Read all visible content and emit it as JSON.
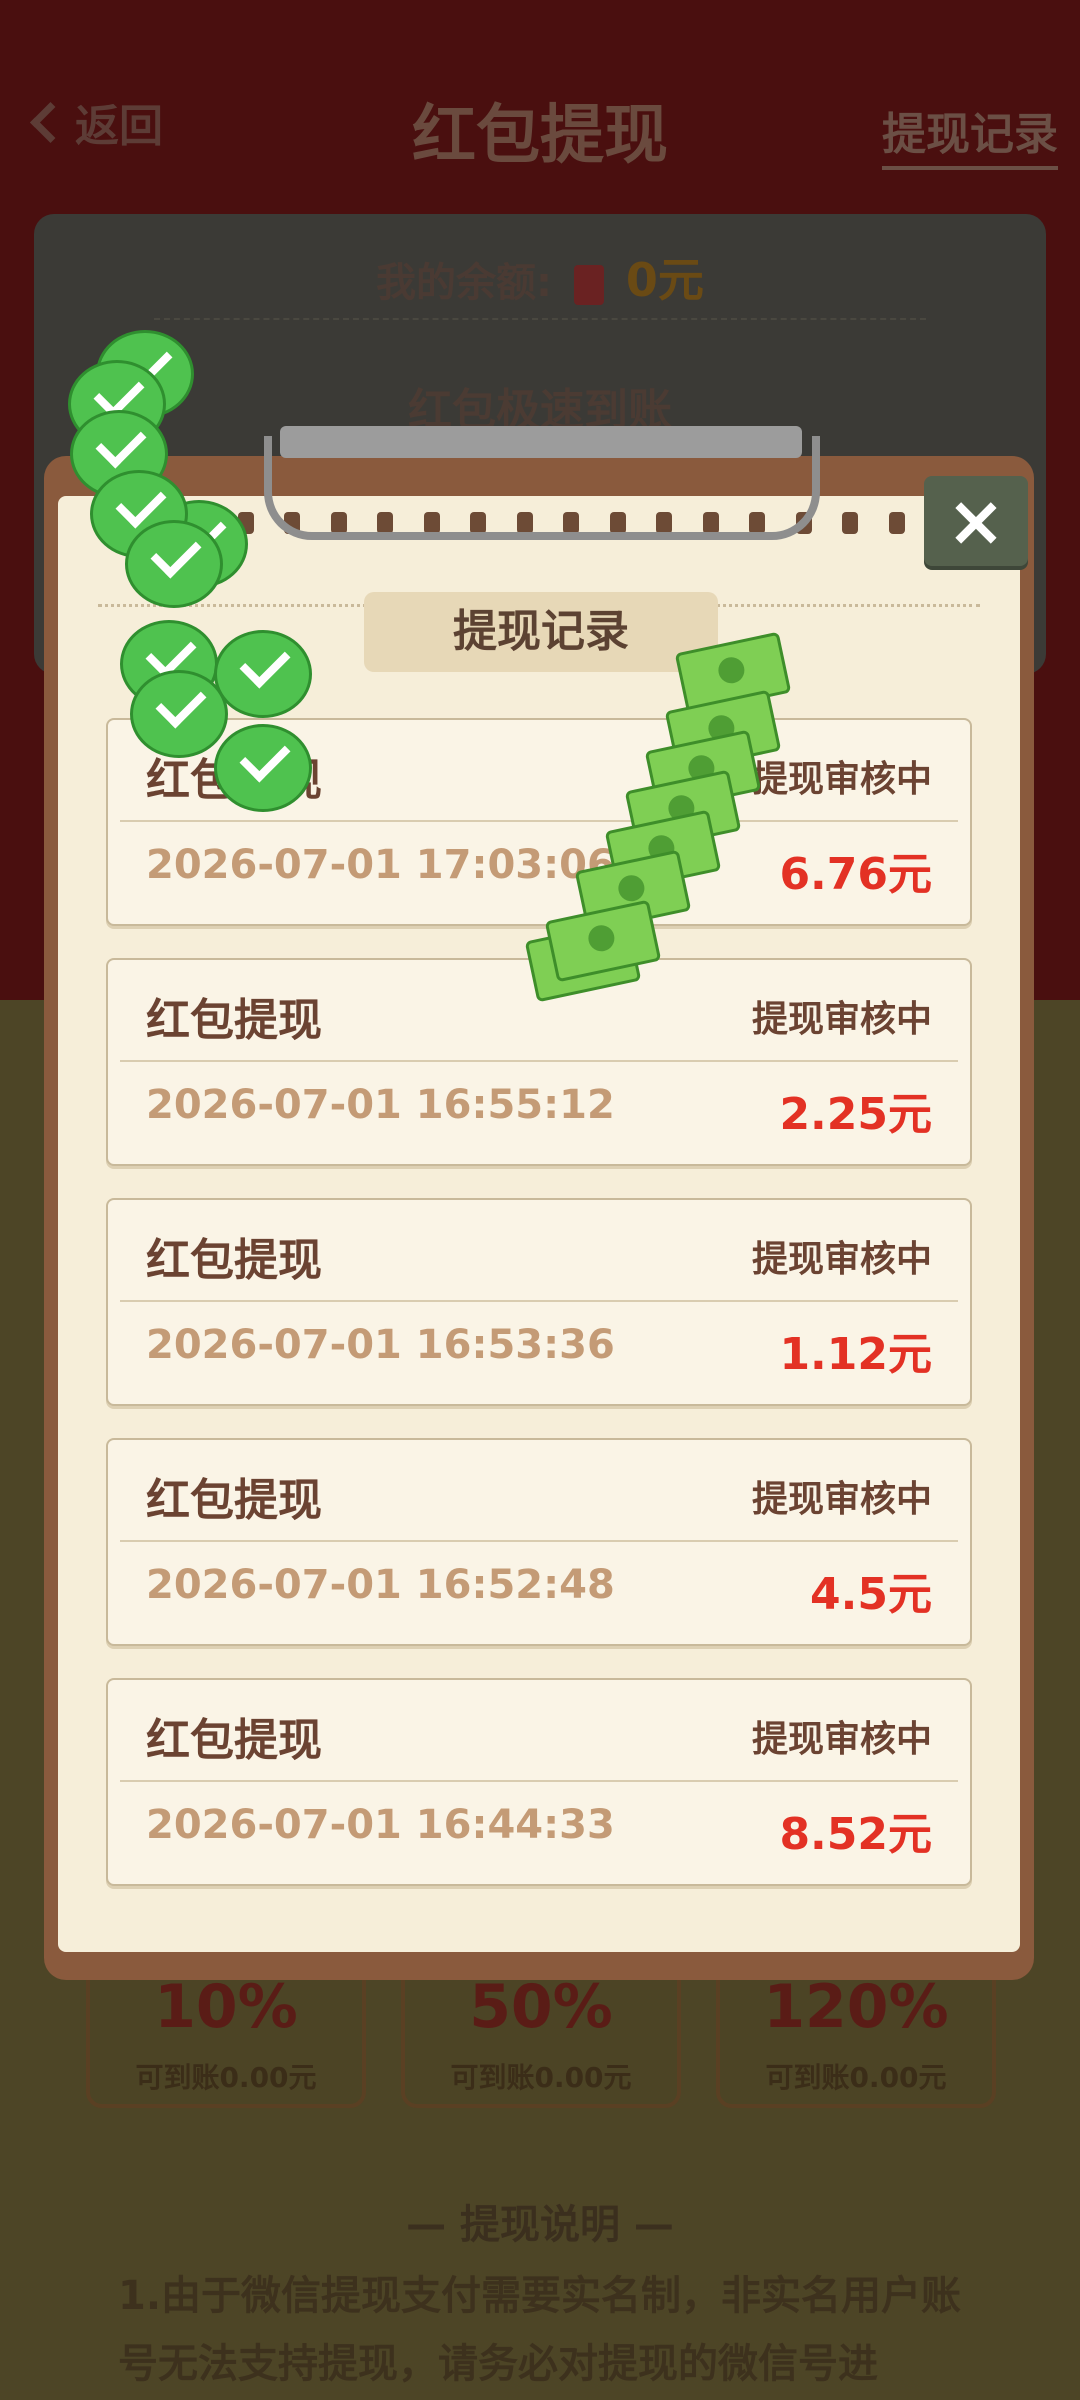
{
  "header": {
    "back_label": "返回",
    "title": "红包提现",
    "records_link": "提现记录"
  },
  "balance": {
    "label": "我的余额:",
    "amount": "0元",
    "speed_label": "红包极速到账"
  },
  "tiers": [
    {
      "percent": "10%",
      "sub": "可到账0.00元"
    },
    {
      "percent": "50%",
      "sub": "可到账0.00元"
    },
    {
      "percent": "120%",
      "sub": "可到账0.00元"
    }
  ],
  "explanation": {
    "title": "— 提现说明 —",
    "text": "1.由于微信提现支付需要实名制，非实名用户账号无法支持提现，请务必对提现的微信号进"
  },
  "modal": {
    "title": "提现记录",
    "close_label": "×",
    "records": [
      {
        "name": "红包提现",
        "status": "提现审核中",
        "time": "2026-07-01 17:03:06",
        "amount": "6.76元"
      },
      {
        "name": "红包提现",
        "status": "提现审核中",
        "time": "2026-07-01 16:55:12",
        "amount": "2.25元"
      },
      {
        "name": "红包提现",
        "status": "提现审核中",
        "time": "2026-07-01 16:53:36",
        "amount": "1.12元"
      },
      {
        "name": "红包提现",
        "status": "提现审核中",
        "time": "2026-07-01 16:52:48",
        "amount": "4.5元"
      },
      {
        "name": "红包提现",
        "status": "提现审核中",
        "time": "2026-07-01 16:44:33",
        "amount": "8.52元"
      }
    ]
  },
  "colors": {
    "amount_red": "#e33124",
    "status_brown": "#6b4332",
    "time_tan": "#c49b76"
  }
}
